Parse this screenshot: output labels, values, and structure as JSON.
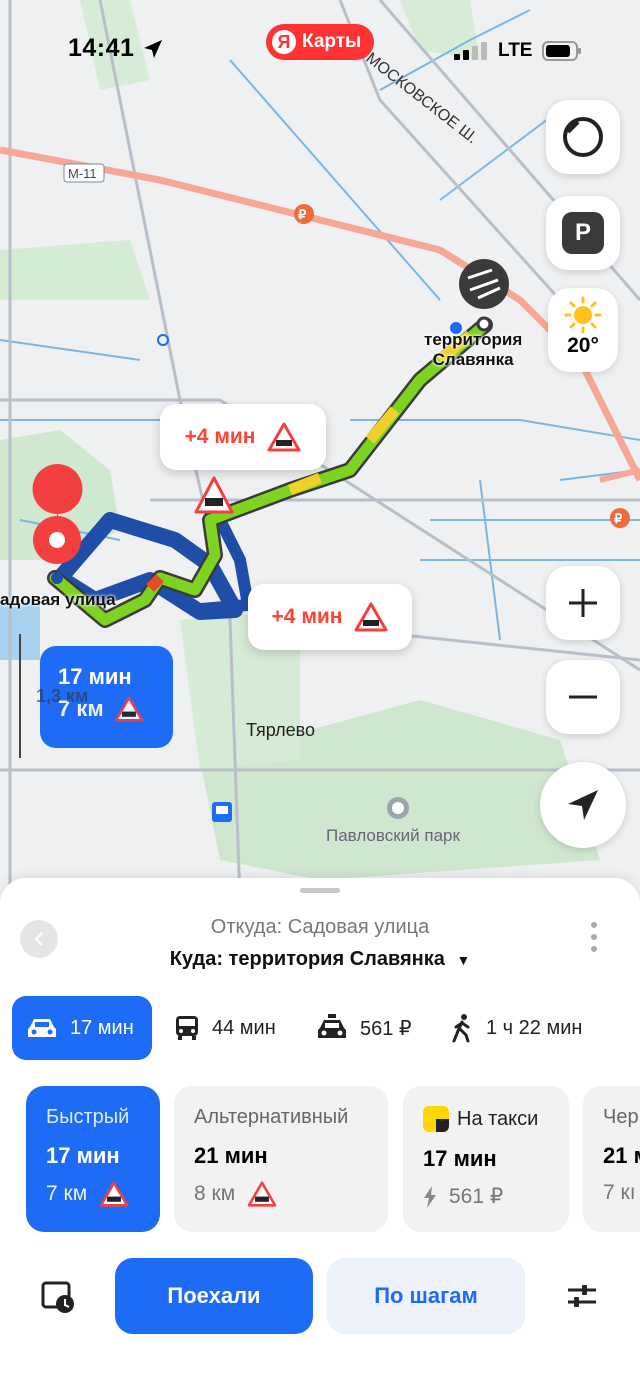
{
  "status": {
    "time": "14:41",
    "network": "LTE"
  },
  "app": {
    "logo_letter": "Я",
    "logo_text": "Карты"
  },
  "map": {
    "road_labels": [
      "М-11",
      "МОСКОВСКОЕ Ш."
    ],
    "destination_label_line1": "территория",
    "destination_label_line2": "Славянка",
    "origin_label": "адовая улица",
    "village_label": "Тярлево",
    "park_label": "Павловский парк",
    "callout_1": "+4 мин",
    "callout_2": "+4 мин",
    "route_badge_time": "17 мин",
    "route_badge_distance": "7 км",
    "scale": "1,3 км",
    "weather_temp": "20°",
    "parking_letter": "P",
    "ruble": "₽"
  },
  "sheet": {
    "from": "Откуда: Садовая улица",
    "to": "Куда: территория Славянка",
    "modes": [
      {
        "icon": "car-icon",
        "label": "17 мин"
      },
      {
        "icon": "bus-icon",
        "label": "44 мин"
      },
      {
        "icon": "taxi-icon",
        "label": "561 ₽"
      },
      {
        "icon": "walk-icon",
        "label": "1 ч 22 мин"
      }
    ],
    "routes": [
      {
        "title": "Быстрый",
        "time": "17 мин",
        "sub": "7 км"
      },
      {
        "title": "Альтернативный",
        "time": "21 мин",
        "sub": "8 км"
      },
      {
        "title": "На такси",
        "time": "17 мин",
        "sub": "561 ₽"
      },
      {
        "title": "Чер",
        "time": "21 м",
        "sub": "7 кı"
      }
    ],
    "go_label": "Поехали",
    "steps_label": "По шагам"
  },
  "colors": {
    "accent": "#1e6bf5",
    "route_green": "#7ed321",
    "alert_red": "#f43f3f"
  }
}
